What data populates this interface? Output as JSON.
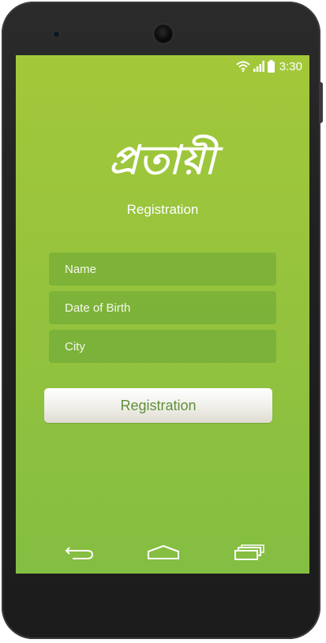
{
  "status_bar": {
    "time": "3:30",
    "icons": [
      "wifi-icon",
      "signal-icon",
      "battery-icon"
    ]
  },
  "app": {
    "logo_text": "প্রতায়ী",
    "subtitle": "Registration"
  },
  "form": {
    "name_placeholder": "Name",
    "dob_placeholder": "Date of Birth",
    "city_placeholder": "City",
    "submit_label": "Registration"
  },
  "nav_bar": {
    "icons": [
      "back-icon",
      "home-icon",
      "recents-icon"
    ]
  },
  "colors": {
    "screen_top": "#a3c83a",
    "screen_bottom": "#84be42",
    "button_text": "#5f8f3a"
  }
}
